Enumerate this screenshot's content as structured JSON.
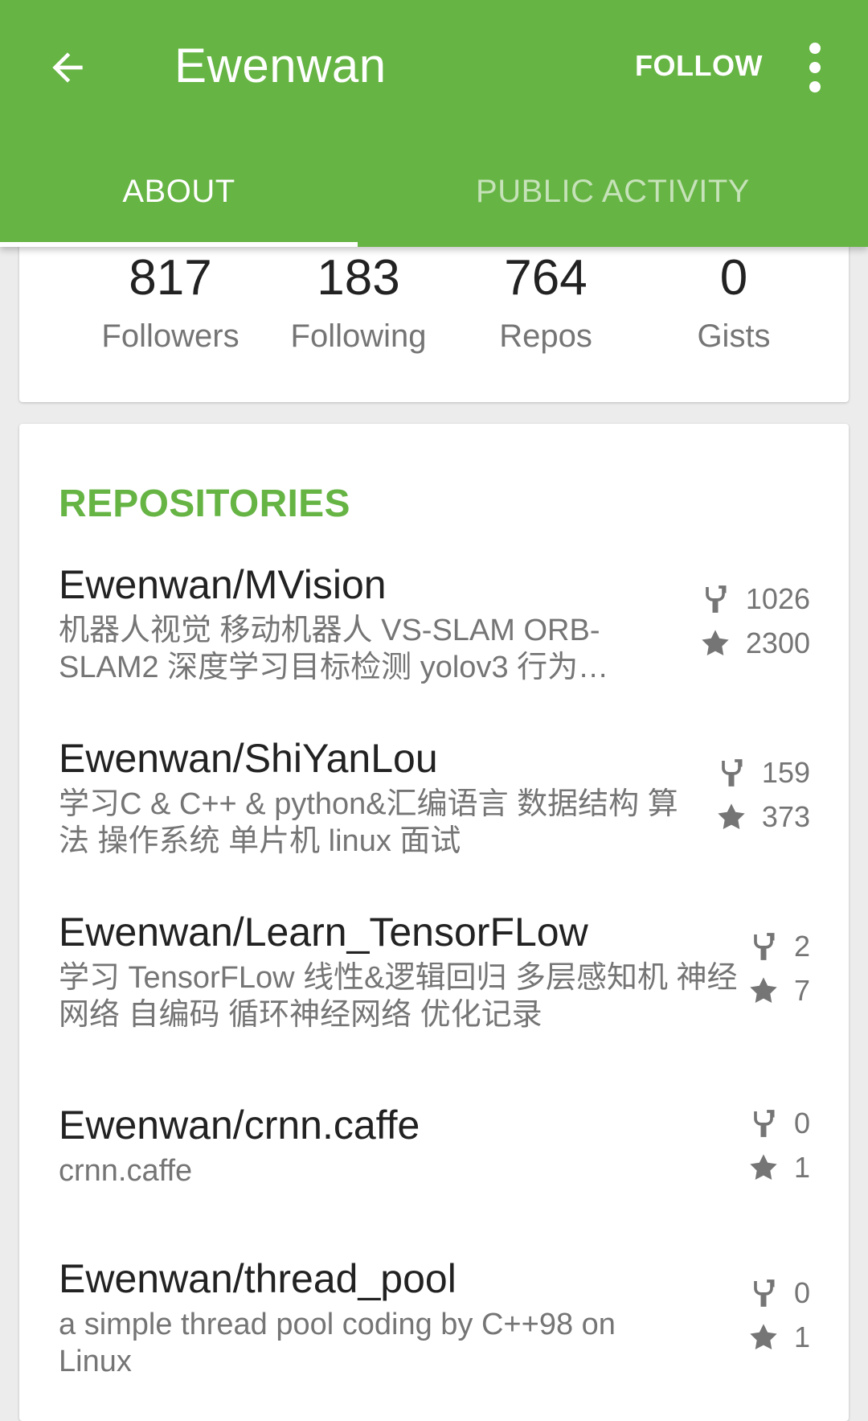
{
  "toolbar": {
    "title": "Ewenwan",
    "follow_label": "FOLLOW",
    "back_icon": "arrow-left-icon",
    "more_icon": "more-vert-icon"
  },
  "tabs": [
    {
      "label": "ABOUT",
      "selected": true
    },
    {
      "label": "PUBLIC ACTIVITY",
      "selected": false
    }
  ],
  "stats": [
    {
      "value": "817",
      "label": "Followers"
    },
    {
      "value": "183",
      "label": "Following"
    },
    {
      "value": "764",
      "label": "Repos"
    },
    {
      "value": "0",
      "label": "Gists"
    }
  ],
  "repositories": {
    "title": "REPOSITORIES",
    "items": [
      {
        "name": "Ewenwan/MVision",
        "description": "机器人视觉 移动机器人 VS-SLAM ORB-SLAM2 深度学习目标检测 yolov3 行为…",
        "forks": "1026",
        "stars": "2300"
      },
      {
        "name": "Ewenwan/ShiYanLou",
        "description": "学习C & C++ & python&汇编语言 数据结构 算法 操作系统 单片机 linux 面试",
        "forks": "159",
        "stars": "373"
      },
      {
        "name": "Ewenwan/Learn_TensorFLow",
        "description": "学习 TensorFLow 线性&逻辑回归 多层感知机 神经网络 自编码 循环神经网络 优化记录",
        "forks": "2",
        "stars": "7"
      },
      {
        "name": "Ewenwan/crnn.caffe",
        "description": "crnn.caffe",
        "forks": "0",
        "stars": "1"
      },
      {
        "name": "Ewenwan/thread_pool",
        "description": "a simple thread pool coding by C++98 on Linux",
        "forks": "0",
        "stars": "1"
      }
    ]
  },
  "colors": {
    "primary": "#66b444",
    "text_primary": "#222222",
    "text_secondary": "#757575",
    "background": "#ececec"
  }
}
